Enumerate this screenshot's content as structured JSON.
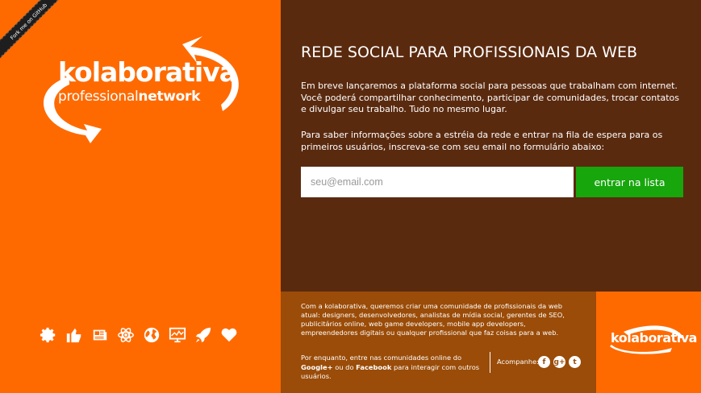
{
  "ribbon": {
    "label": "Fork me on GitHub"
  },
  "logo": {
    "title": "kolaborativa",
    "sub_regular": "professional",
    "sub_bold": "network"
  },
  "icons": [
    "gear-icon",
    "thumbs-up-icon",
    "newspaper-icon",
    "atom-icon",
    "globe-icon",
    "chart-monitor-icon",
    "rocket-icon",
    "heart-icon"
  ],
  "main": {
    "heading": "REDE SOCIAL PARA PROFISSIONAIS DA WEB",
    "paragraph1": "Em breve lançaremos a plataforma social para pessoas que trabalham com internet. Você poderá compartilhar conhecimento, participar de comunidades, trocar contatos e divulgar seu trabalho. Tudo no mesmo lugar.",
    "paragraph2": "Para saber informações sobre a estréia da rede e entrar na fila de espera para os primeiros usuários, inscreva-se com seu email no formulário abaixo:",
    "email_placeholder": "seu@email.com",
    "submit_label": "entrar na lista"
  },
  "footer": {
    "about": "Com a kolaborativa, queremos criar uma comunidade de profissionais da web atual: designers, desenvolvedores, analistas de mídia social, gerentes de SEO, publicitários online, web game developers, mobile app developers, empreendedores digitais ou qualquer profissional que faz coisas para a web.",
    "communities_pre": "Por enquanto, entre nas comunidades online do ",
    "google": "Google+",
    "communities_mid": " ou do ",
    "facebook": "Facebook",
    "communities_post": " para interagir com outros usuários.",
    "follow_label": "Acompanhe:",
    "social": [
      "f",
      "g+",
      "t"
    ]
  },
  "corner": {
    "logo_text": "kolaborativa"
  }
}
